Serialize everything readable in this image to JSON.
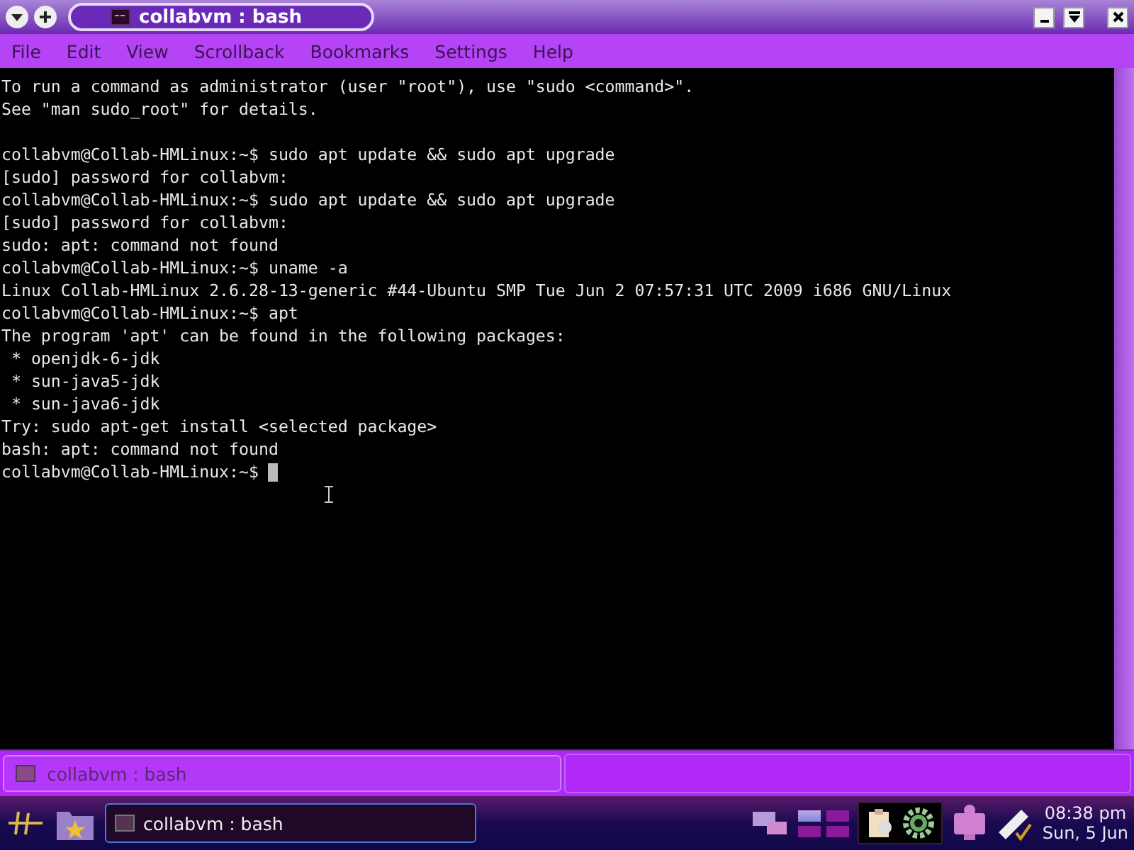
{
  "window": {
    "title": "collabvm : bash"
  },
  "menu": [
    "File",
    "Edit",
    "View",
    "Scrollback",
    "Bookmarks",
    "Settings",
    "Help"
  ],
  "terminal": {
    "banner": [
      "To run a command as administrator (user \"root\"), use \"sudo <command>\".",
      "See \"man sudo_root\" for details."
    ],
    "lines": [
      "collabvm@Collab-HMLinux:~$ sudo apt update && sudo apt upgrade",
      "[sudo] password for collabvm:",
      "collabvm@Collab-HMLinux:~$ sudo apt update && sudo apt upgrade",
      "[sudo] password for collabvm:",
      "sudo: apt: command not found",
      "collabvm@Collab-HMLinux:~$ uname -a",
      "Linux Collab-HMLinux 2.6.28-13-generic #44-Ubuntu SMP Tue Jun 2 07:57:31 UTC 2009 i686 GNU/Linux",
      "collabvm@Collab-HMLinux:~$ apt",
      "The program 'apt' can be found in the following packages:",
      " * openjdk-6-jdk",
      " * sun-java5-jdk",
      " * sun-java6-jdk",
      "Try: sudo apt-get install <selected package>",
      "bash: apt: command not found",
      "collabvm@Collab-HMLinux:~$ "
    ],
    "cursor": true
  },
  "session_tabs": [
    {
      "label": "collabvm : bash",
      "selected": true
    }
  ],
  "taskbar": {
    "tasks": [
      {
        "label": "collabvm : bash",
        "selected": true
      }
    ],
    "pager": [
      {
        "selected": true
      },
      {
        "selected": false
      },
      {
        "selected": false
      },
      {
        "selected": false
      }
    ],
    "clock": {
      "time": "08:38 pm",
      "date": "Sun, 5 Jun"
    }
  }
}
